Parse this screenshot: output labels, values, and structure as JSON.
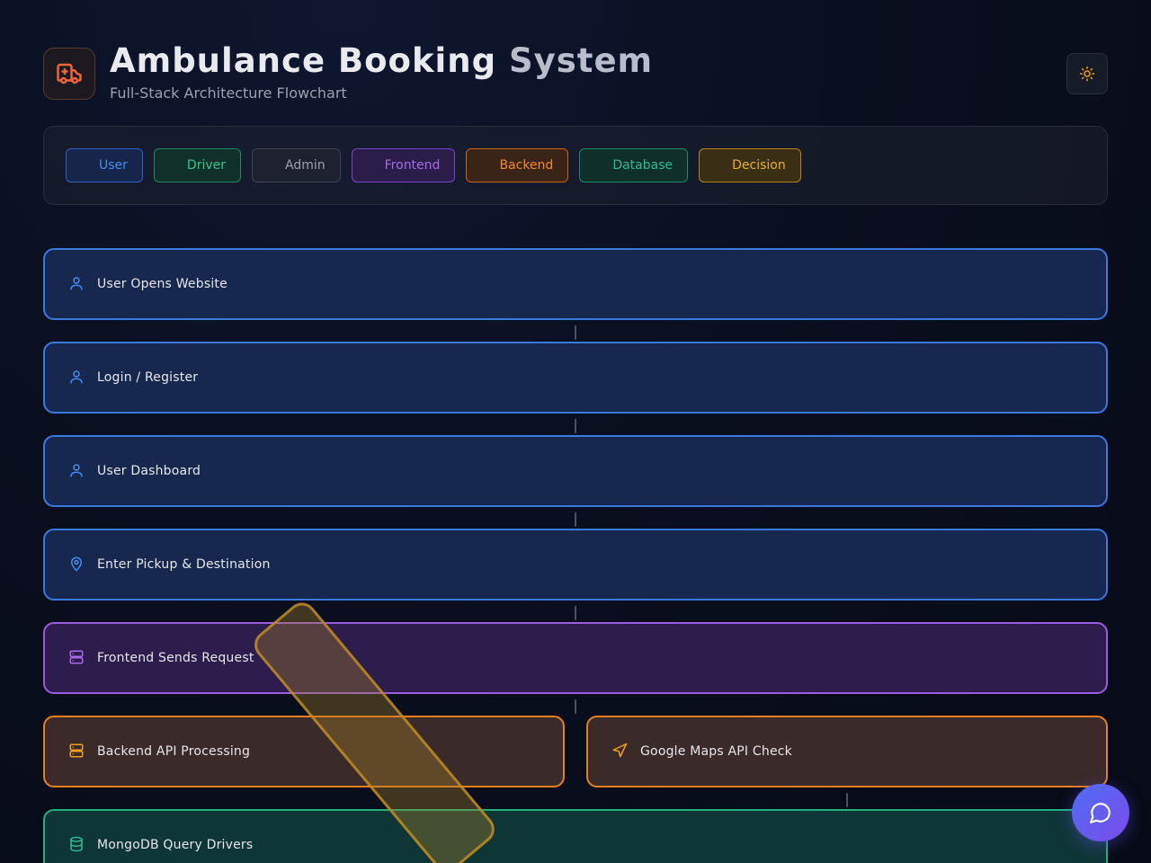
{
  "header": {
    "title_part1": "Ambulance Booking",
    "title_part2": "System",
    "subtitle": "Full-Stack Architecture Flowchart",
    "logo_icon": "ambulance-icon",
    "theme_toggle_icon": "sun-icon"
  },
  "legend": {
    "items": [
      {
        "label": "User",
        "color": "#4a8cf0"
      },
      {
        "label": "Driver",
        "color": "#34c98a"
      },
      {
        "label": "Admin",
        "color": "#9aa0b0"
      },
      {
        "label": "Frontend",
        "color": "#a76ae8"
      },
      {
        "label": "Backend",
        "color": "#f08a2a"
      },
      {
        "label": "Database",
        "color": "#2fbd8e"
      },
      {
        "label": "Decision",
        "color": "#e8b030"
      }
    ]
  },
  "flow": {
    "nodes": [
      {
        "label": "User Opens Website",
        "category": "user",
        "icon": "user-icon"
      },
      {
        "label": "Login / Register",
        "category": "user",
        "icon": "user-icon"
      },
      {
        "label": "User Dashboard",
        "category": "user",
        "icon": "user-icon"
      },
      {
        "label": "Enter Pickup & Destination",
        "category": "user",
        "icon": "map-pin-icon"
      },
      {
        "label": "Frontend Sends Request",
        "category": "frontend",
        "icon": "server-icon"
      },
      {
        "label": "Backend API Processing",
        "category": "backend",
        "icon": "server-icon"
      },
      {
        "label": "Google Maps API Check",
        "category": "backend",
        "icon": "navigation-icon"
      },
      {
        "label": "MongoDB Query Drivers",
        "category": "database",
        "icon": "database-icon"
      }
    ]
  },
  "chat": {
    "icon": "chat-bubble-icon"
  }
}
